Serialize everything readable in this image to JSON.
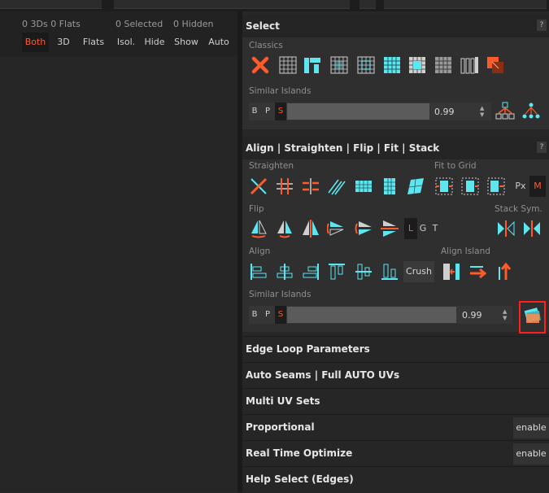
{
  "left": {
    "counts": {
      "threed_flats": "0 3Ds 0 Flats",
      "selected": "0 Selected",
      "hidden": "0 Hidden"
    },
    "buttons": {
      "both": "Both",
      "threed": "3D",
      "flats": "Flats",
      "isol": "Isol.",
      "hide": "Hide",
      "show": "Show",
      "auto": "Auto"
    }
  },
  "select": {
    "title": "Select",
    "help": "?",
    "classics_label": "Classics",
    "similar_label": "Similar Islands",
    "bps": [
      "B",
      "P",
      "S"
    ],
    "value": "0.99"
  },
  "align": {
    "title": "Align | Straighten | Flip | Fit | Stack",
    "help": "?",
    "straighten_label": "Straighten",
    "fit_label": "Fit to Grid",
    "px": "Px",
    "m": "M",
    "flip_label": "Flip",
    "stack_label": "Stack Sym.",
    "lgt": [
      "L",
      "G",
      "T"
    ],
    "align_label": "Align",
    "align_island_label": "Align Island",
    "crush": "Crush",
    "similar_label": "Similar Islands",
    "bps": [
      "B",
      "P",
      "S"
    ],
    "value": "0.99"
  },
  "sections": {
    "edge_loop": "Edge Loop Parameters",
    "auto_seams": "Auto Seams | Full AUTO UVs",
    "multi_uv": "Multi UV Sets",
    "proportional": "Proportional",
    "realtime": "Real Time Optimize",
    "help_select": "Help Select (Edges)",
    "enable": "enable"
  },
  "colors": {
    "accent": "#ff5a2a",
    "cyan": "#5ee6f0",
    "highlight": "#ff1f1f"
  }
}
